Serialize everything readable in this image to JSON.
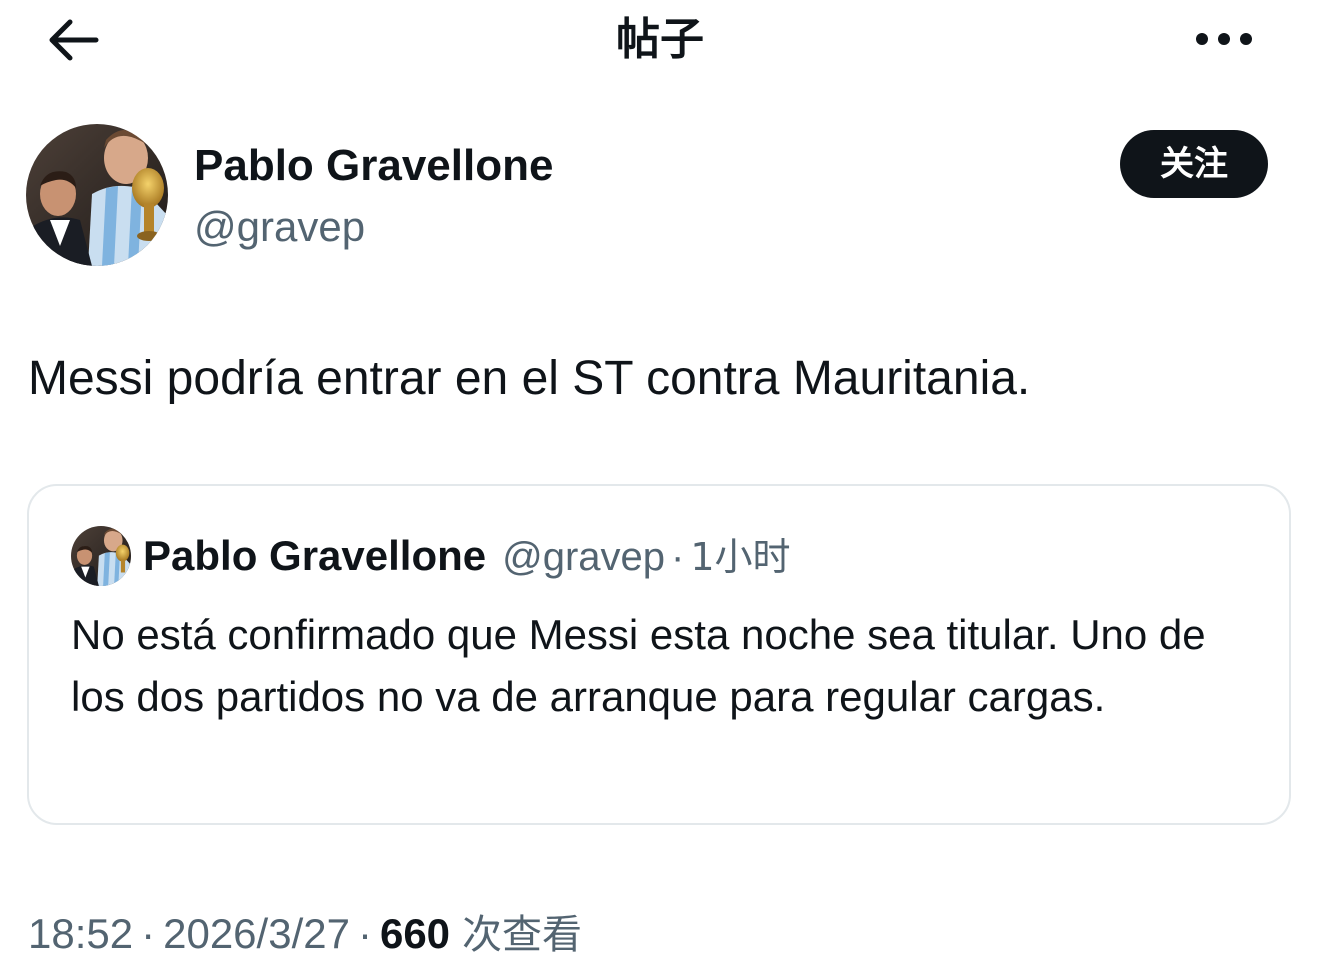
{
  "header": {
    "title": "帖子",
    "back_icon": "arrow-left-icon",
    "more_icon": "more-horizontal-icon"
  },
  "author": {
    "name": "Pablo Gravellone",
    "handle": "@gravep",
    "follow_label": "关注"
  },
  "post": {
    "text": "Messi podría entrar en el ST contra Mauritania."
  },
  "quoted_post": {
    "name": "Pablo Gravellone",
    "handle": "@gravep",
    "separator": "·",
    "time": "1小时",
    "text": "No está confirmado que Messi esta noche sea titular. Uno de los dos partidos no va de arranque para regular cargas."
  },
  "meta": {
    "time": "18:52",
    "separator": "·",
    "date": "2026/3/27",
    "views_count": "660",
    "views_label": "次查看"
  },
  "colors": {
    "text_primary": "#0f1419",
    "text_secondary": "#536471",
    "border": "#e3e8eb",
    "follow_button_bg": "#0f1419",
    "follow_button_text": "#ffffff"
  }
}
